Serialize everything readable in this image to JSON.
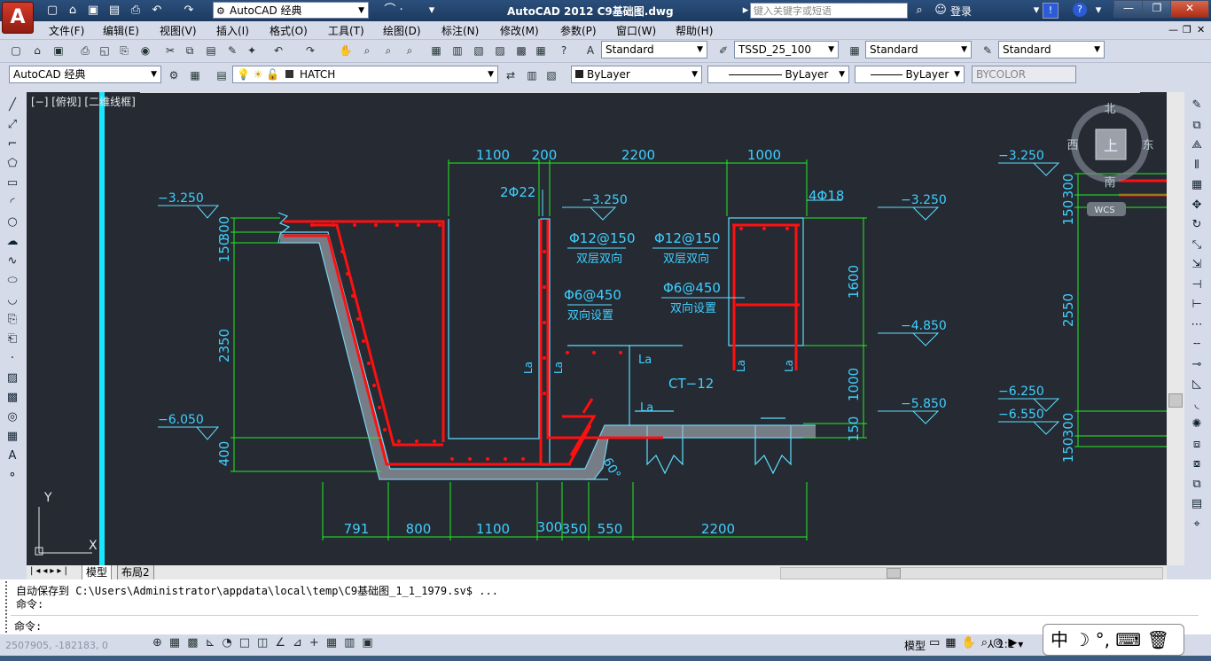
{
  "app": {
    "title": "AutoCAD 2012    C9基础图.dwg",
    "logo_letter": "A"
  },
  "title_bar": {
    "workspace": "AutoCAD 经典",
    "search_placeholder": "键入关键字或短语",
    "login": "登录",
    "help_icon": "?"
  },
  "menu": {
    "items": [
      "文件(F)",
      "编辑(E)",
      "视图(V)",
      "插入(I)",
      "格式(O)",
      "工具(T)",
      "绘图(D)",
      "标注(N)",
      "修改(M)",
      "参数(P)",
      "窗口(W)",
      "帮助(H)"
    ]
  },
  "toolbar2": {
    "text_style": "Standard",
    "dim_style": "TSSD_25_100",
    "table_style": "Standard",
    "mleader_style": "Standard"
  },
  "toolbar3": {
    "workspace": "AutoCAD 经典",
    "layer": "HATCH",
    "color": "ByLayer",
    "linetype": "ByLayer",
    "lineweight": "ByLayer",
    "plotstyle": "BYCOLOR"
  },
  "viewport": {
    "label": "[−] [俯视] [二维线框]",
    "viewcube": {
      "top": "上",
      "north": "北",
      "south": "南",
      "east": "东",
      "west": "西",
      "wcs": "WCS"
    },
    "ucs": {
      "x": "X",
      "y": "Y"
    }
  },
  "drawing": {
    "dim_top": [
      "1100",
      "200",
      "2200",
      "1000"
    ],
    "dim_bottom": [
      "791",
      "800",
      "1100",
      "300",
      "350",
      "550",
      "2200"
    ],
    "dim_left": [
      "300",
      "150",
      "2350",
      "400"
    ],
    "dim_right": [
      "1600",
      "1000",
      "150"
    ],
    "dim_right2": [
      "300",
      "150",
      "2550",
      "300",
      "150"
    ],
    "levels_left": [
      "−3.250",
      "−6.050"
    ],
    "levels_mid": [
      "−3.250"
    ],
    "levels_right": [
      "−3.250",
      "−4.850",
      "−5.850"
    ],
    "levels_far": [
      "−3.250",
      "−6.250",
      "−6.550"
    ],
    "rebar_2": "2Φ22",
    "rebar_4": "4Φ18",
    "note1_a": "Φ12@150",
    "note1_b": "双层双向",
    "note2_a": "Φ6@450",
    "note2_b": "双向设置",
    "note3_a": "Φ12@150",
    "note3_b": "双层双向",
    "note4_a": "Φ6@450",
    "note4_b": "双向设置",
    "la": "La",
    "ct": "CT−12",
    "angle": "60°"
  },
  "tabs": {
    "model": "模型",
    "layout": "布局2"
  },
  "command": {
    "line1": "自动保存到 C:\\Users\\Administrator\\appdata\\local\\temp\\C9基础图_1_1_1979.sv$ ...",
    "line2": "命令:",
    "prompt": "命令:"
  },
  "status": {
    "coords": "2507905, -182183, 0",
    "model": "模型",
    "scale": "1:1"
  },
  "colors": {
    "canvas": "#252a33",
    "rebar": "#ff1010",
    "dim": "#22ee22",
    "text": "#3fd0ff",
    "outline": "#5fdfff"
  }
}
